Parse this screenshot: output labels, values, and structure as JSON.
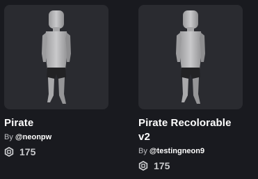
{
  "items": [
    {
      "name": "Pirate",
      "by_label": "By",
      "creator": "@neonpw",
      "price": "175",
      "currency_icon": "robux-icon"
    },
    {
      "name": "Pirate Recolorable v2",
      "by_label": "By",
      "creator": "@testingneon9",
      "price": "175",
      "currency_icon": "robux-icon"
    }
  ],
  "colors": {
    "background": "#191a1f",
    "card_thumb": "#2a2b30",
    "text": "#ffffff",
    "muted_text": "#c8c9cc"
  }
}
